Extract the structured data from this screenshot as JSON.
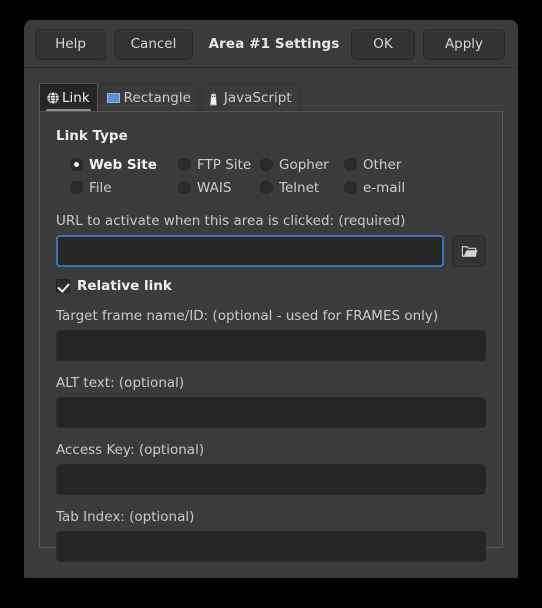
{
  "window": {
    "title": "Area #1 Settings"
  },
  "header": {
    "buttons": [
      {
        "id": "help",
        "label": "Help"
      },
      {
        "id": "cancel",
        "label": "Cancel"
      },
      {
        "id": "ok",
        "label": "OK"
      },
      {
        "id": "apply",
        "label": "Apply"
      }
    ]
  },
  "tabs": [
    {
      "label": "Link",
      "icon": "globe-icon",
      "active": true
    },
    {
      "label": "Rectangle",
      "icon": "rectangle-icon",
      "active": false
    },
    {
      "label": "JavaScript",
      "icon": "java-duke-icon",
      "active": false
    }
  ],
  "link_tab": {
    "link_type": {
      "title": "Link Type",
      "selected": "Web Site",
      "row1": [
        {
          "label": "Web Site",
          "selected": true
        },
        {
          "label": "FTP Site",
          "selected": false
        },
        {
          "label": "Gopher",
          "selected": false
        },
        {
          "label": "Other",
          "selected": false
        }
      ],
      "row2": [
        {
          "label": "File",
          "selected": false
        },
        {
          "label": "WAIS",
          "selected": false
        },
        {
          "label": "Telnet",
          "selected": false
        },
        {
          "label": "e-mail",
          "selected": false
        }
      ]
    },
    "url_field": {
      "label": "URL to activate when this area is clicked: (required)",
      "value": "",
      "placeholder": "",
      "focused": true,
      "browse_icon": "folder-open-icon"
    },
    "relative_link": {
      "label": "Relative link",
      "checked": true
    },
    "target_frame": {
      "label": "Target frame name/ID: (optional - used for FRAMES only)",
      "value": "",
      "placeholder": ""
    },
    "alt_text": {
      "label": "ALT text: (optional)",
      "value": "",
      "placeholder": ""
    },
    "access_key": {
      "label": "Access Key: (optional)",
      "value": "",
      "placeholder": ""
    },
    "tab_index": {
      "label": "Tab Index: (optional)",
      "value": "",
      "placeholder": ""
    }
  },
  "colors": {
    "window_bg": "#3b3b3b",
    "input_bg": "#262626",
    "focus_border": "#3b72c0",
    "rectangle_icon": "#5b8fd4",
    "text": "#cfcfcf",
    "text_bright": "#f0f0f0"
  }
}
